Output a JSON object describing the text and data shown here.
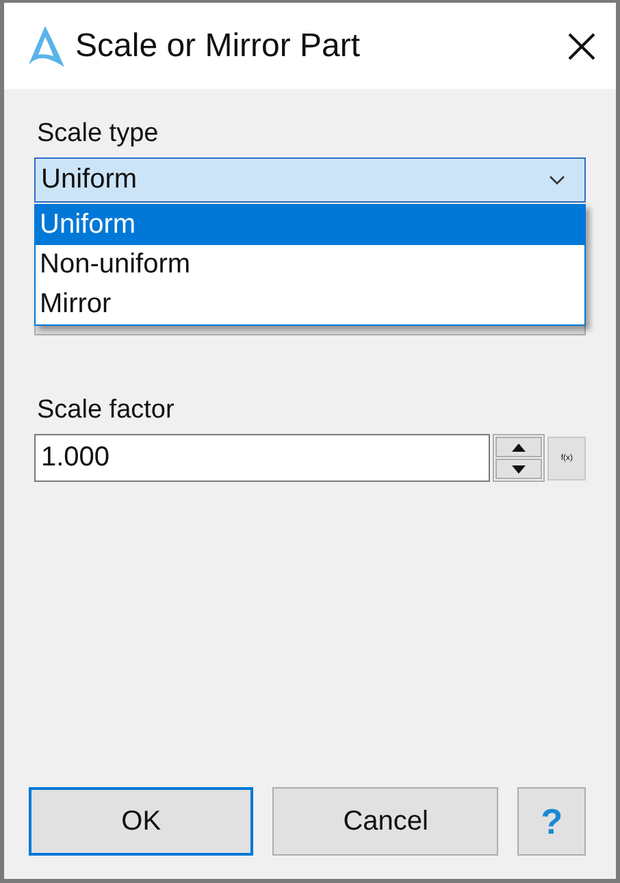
{
  "window": {
    "title": "Scale or Mirror Part"
  },
  "scale_type": {
    "label": "Scale type",
    "value": "Uniform",
    "expanded": true,
    "options": [
      {
        "label": "Uniform",
        "selected": true
      },
      {
        "label": "Non-uniform",
        "selected": false
      },
      {
        "label": "Mirror",
        "selected": false
      }
    ]
  },
  "transform_field": {
    "disabled": true
  },
  "scale_factor": {
    "label": "Scale factor",
    "value": "1.000",
    "formula_button": "f(x)"
  },
  "buttons": [
    {
      "label": "OK",
      "kind": "default"
    },
    {
      "label": "Cancel",
      "kind": "normal"
    },
    {
      "label": "?",
      "kind": "help"
    }
  ]
}
